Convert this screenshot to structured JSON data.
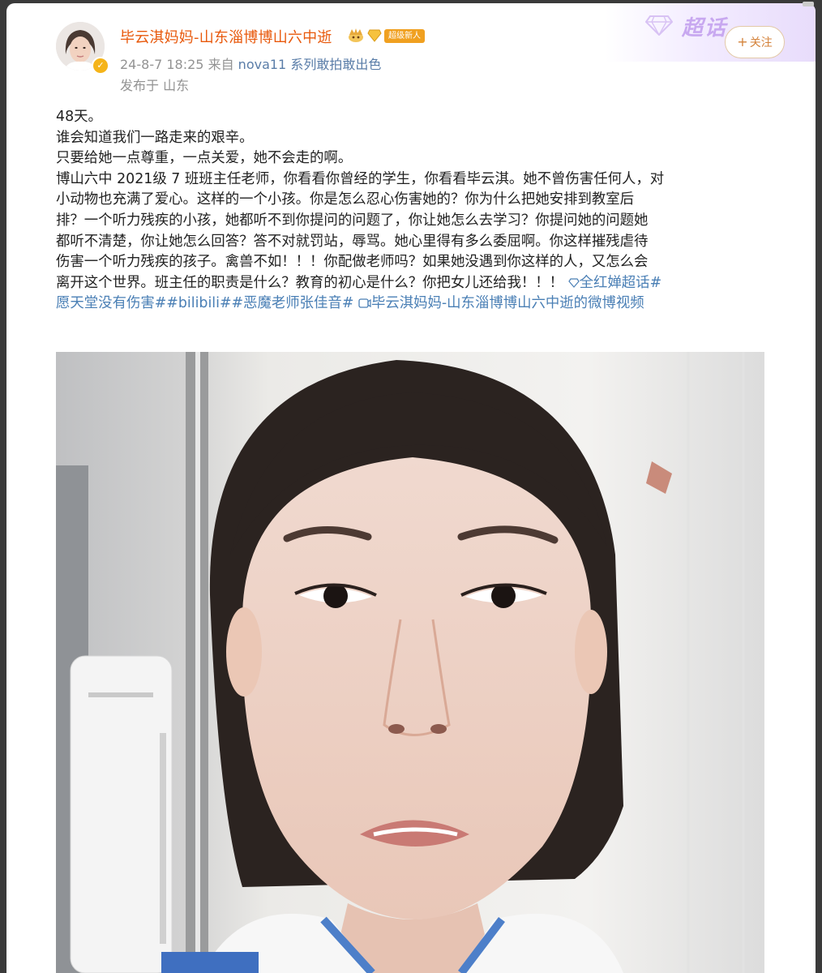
{
  "user": {
    "name": "毕云淇妈妈-山东淄博博山六中逝",
    "badge_new": "超级新人",
    "icons": [
      "crown-icon",
      "diamond-icon"
    ]
  },
  "meta": {
    "date": "24-8-7 18:25",
    "from_label": "来自",
    "source": "nova11 系列敢拍敢出色",
    "location": "发布于 山东"
  },
  "banner": {
    "text": "超话"
  },
  "follow_button": {
    "plus": "+",
    "label": "关注"
  },
  "post": {
    "lines": [
      "48天。",
      "谁会知道我们一路走来的艰辛。",
      "只要给她一点尊重，一点关爱，她不会走的啊。",
      "博山六中 2021级 7 班班主任老师，你看看你曾经的学生，你看看毕云淇。她不曾伤害任何人，对",
      "小动物也充满了爱心。这样的一个小孩。你是怎么忍心伤害她的？你为什么把她安排到教室后",
      "排？一个听力残疾的小孩，她都听不到你提问的问题了，你让她怎么去学习？你提问她的问题她",
      "都听不清楚，你让她怎么回答？答不对就罚站，辱骂。她心里得有多么委屈啊。你这样摧残虐待",
      "伤害一个听力残疾的孩子。禽兽不如！！！你配做老师吗？如果她没遇到你这样的人，又怎么会"
    ],
    "last_line_text": "离开这个世界。班主任的职责是什么？教育的初心是什么？你把女儿还给我！！！",
    "tags_line1": "全红婵超话#",
    "tags_line2": "愿天堂没有伤害##bilibili##恶魔老师张佳音#",
    "video_link": "毕云淇妈妈-山东淄博博山六中逝的微博视频"
  }
}
